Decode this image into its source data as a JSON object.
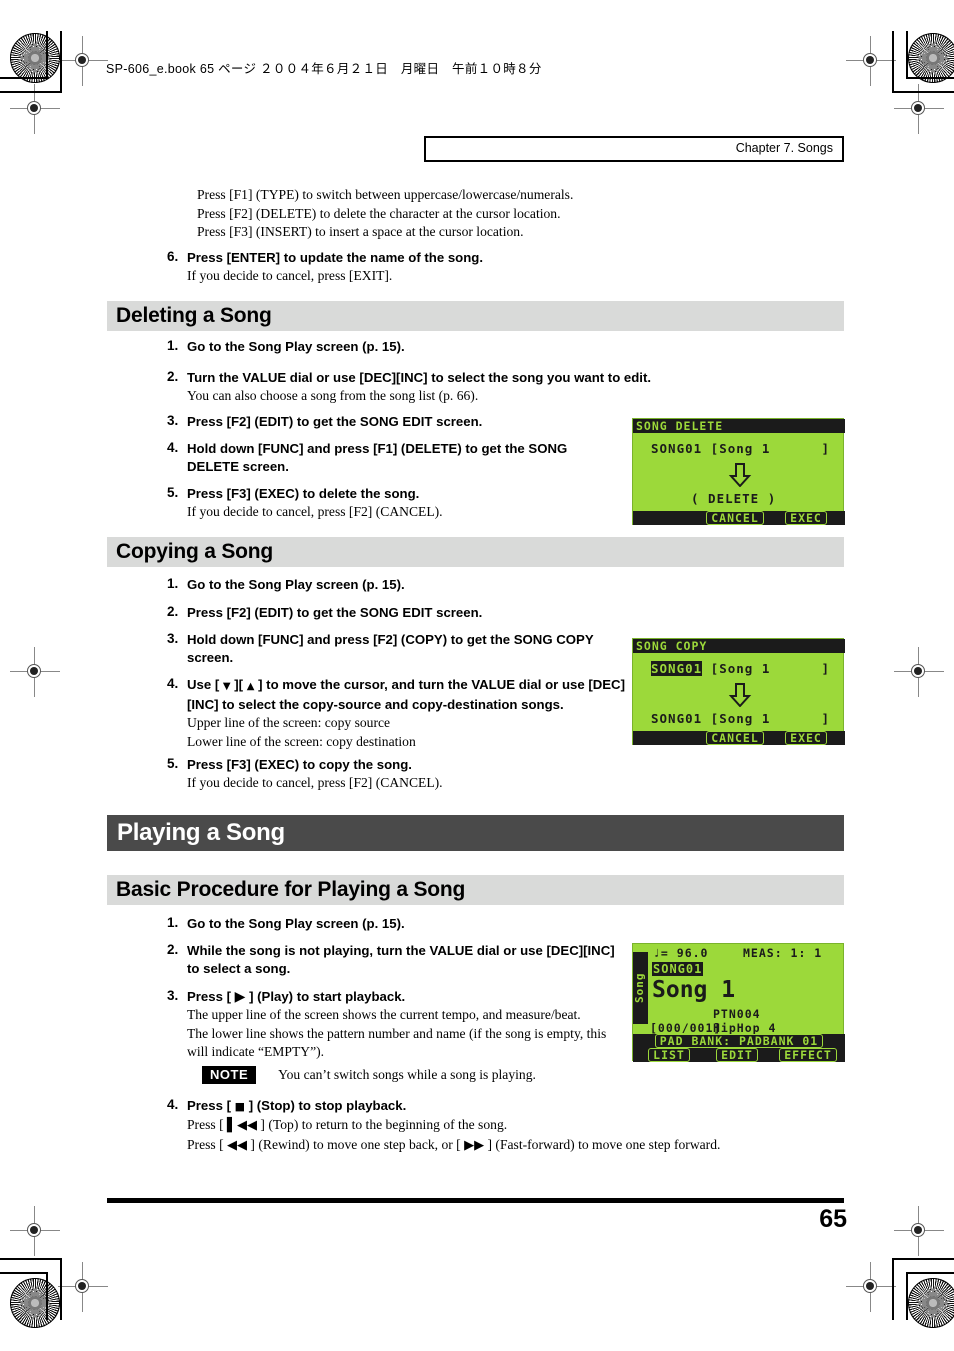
{
  "print_marks": {
    "file_line": "SP-606_e.book 65 ページ ２００４年６月２１日　月曜日　午前１０時８分"
  },
  "header": {
    "chapter": "Chapter 7. Songs"
  },
  "intro": {
    "lines": [
      "Press [F1] (TYPE) to switch between uppercase/lowercase/numerals.",
      "Press [F2] (DELETE) to delete the character at the cursor location.",
      "Press [F3] (INSERT) to insert a space at the cursor location."
    ],
    "step6_num": "6.",
    "step6_bold": "Press [ENTER] to update the name of the song.",
    "step6_body": "If you decide to cancel, press [EXIT]."
  },
  "deleting": {
    "heading": "Deleting a Song",
    "steps": [
      {
        "num": "1.",
        "bold": "Go to the Song Play screen (p. 15).",
        "body": ""
      },
      {
        "num": "2.",
        "bold": "Turn the VALUE dial or use [DEC][INC] to select the song you want to edit.",
        "body": "You can also choose a song from the song list (p. 66)."
      },
      {
        "num": "3.",
        "bold": "Press [F2] (EDIT) to get the SONG EDIT screen.",
        "body": ""
      },
      {
        "num": "4.",
        "bold": "Hold down [FUNC] and press [F1] (DELETE) to get the SONG DELETE screen.",
        "body": ""
      },
      {
        "num": "5.",
        "bold": "Press [F3] (EXEC) to delete the song.",
        "body": "If you decide to cancel, press [F2] (CANCEL)."
      }
    ]
  },
  "copying": {
    "heading": "Copying a Song",
    "steps": [
      {
        "num": "1.",
        "bold": "Go to the Song Play screen (p. 15).",
        "body": ""
      },
      {
        "num": "2.",
        "bold": "Press [F2] (EDIT) to get the SONG EDIT screen.",
        "body": ""
      },
      {
        "num": "3.",
        "bold": "Hold down [FUNC] and press [F2] (COPY) to get the SONG COPY screen.",
        "body": ""
      },
      {
        "num": "4.",
        "bold_pre": "Use [ ",
        "bold_mid": " ][ ",
        "bold_post": " ] to move the cursor, and turn the VALUE dial or use [DEC][INC] to select the copy-source and copy-destination songs.",
        "down_glyph": "▼",
        "up_glyph": "▲",
        "body1": "Upper line of the screen: copy source",
        "body2": "Lower line of the screen: copy destination"
      },
      {
        "num": "5.",
        "bold": "Press [F3] (EXEC) to copy the song.",
        "body": "If you decide to cancel, press [F2] (CANCEL)."
      }
    ]
  },
  "playing": {
    "h1": "Playing a Song",
    "h2": "Basic Procedure for Playing a Song",
    "steps": [
      {
        "num": "1.",
        "bold": "Go to the Song Play screen (p. 15).",
        "body": ""
      },
      {
        "num": "2.",
        "bold": "While the song is not playing, turn the VALUE dial or use [DEC][INC] to select a song.",
        "body": ""
      },
      {
        "num": "3.",
        "bold_pre": "Press [ ",
        "play_glyph": "▶",
        "bold_post": " ] (Play) to start playback.",
        "body1": "The upper line of the screen shows the current tempo, and measure/beat.",
        "body2": "The lower line shows the pattern number and name (if the song is empty, this will indicate “EMPTY”)."
      },
      {
        "num": "4.",
        "bold_pre": "Press [ ",
        "stop_glyph": "■",
        "bold_post": " ] (Stop) to stop playback.",
        "body1_pre": "Press [ ",
        "top_glyph": "◀◀",
        "top_bar": "▌",
        "body1_post": " ] (Top) to return to the beginning of the song.",
        "body2_pre": "Press [ ",
        "rew_glyph": "◀◀",
        "body2_mid": " ] (Rewind) to move one step back, or [ ",
        "ff_glyph": "▶▶",
        "body2_post": " ] (Fast-forward) to move one step forward."
      }
    ],
    "note_label": "NOTE",
    "note_text": "You can’t switch songs while a song is playing."
  },
  "lcd_delete": {
    "title": "SONG DELETE",
    "line1": "SONG01 [Song 1      ]",
    "arrow": "down-arrow",
    "line2": "( DELETE )",
    "soft1": "CANCEL",
    "soft2": "EXEC"
  },
  "lcd_copy": {
    "title": "SONG COPY",
    "line1_selected": "SONG01",
    "line1_rest": " [Song 1      ]",
    "arrow": "down-arrow",
    "line2": "SONG01 [Song 1      ]",
    "soft1": "CANCEL",
    "soft2": "EXEC"
  },
  "lcd_play": {
    "vertical_label": "Song",
    "tempo": "♩= 96.0",
    "meas": "MEAS: 1: 1",
    "song_number": "SONG01",
    "song_name": "Song 1",
    "pattern_number": "PTN004",
    "step": "[000/001]",
    "pattern_name": "HipHop 4",
    "padbank": "PAD BANK: PADBANK 01",
    "soft1": "LIST",
    "soft2": "EDIT",
    "soft3": "EFFECT"
  },
  "footer": {
    "page_number": "65"
  },
  "colors": {
    "lcd_green": "#9cd93a",
    "lcd_dark": "#1b1b1b",
    "h1_bar": "#4a4a4a",
    "h2_bar": "#d9dad9"
  }
}
